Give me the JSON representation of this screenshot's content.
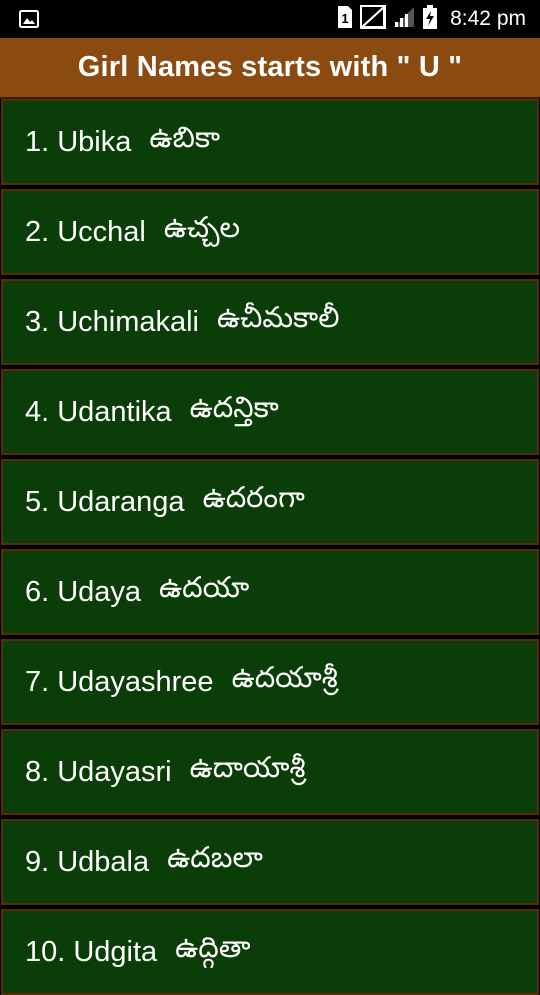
{
  "status_bar": {
    "time": "8:42 pm",
    "sim_label": "1",
    "icons": [
      "image-icon",
      "sim-card-icon",
      "no-signal-icon",
      "signal-icon",
      "battery-charging-icon"
    ]
  },
  "header": {
    "title": "Girl Names starts with \" U \""
  },
  "colors": {
    "header_bg": "#8b4a10",
    "item_bg": "#0b3d08",
    "item_border": "#5a2b0b"
  },
  "names": [
    {
      "num": "1.",
      "english": "Ubika",
      "telugu": "ఉబికా"
    },
    {
      "num": "2.",
      "english": "Ucchal",
      "telugu": "ఉచ్చల"
    },
    {
      "num": "3.",
      "english": "Uchimakali",
      "telugu": "ఉచీమకాలీ"
    },
    {
      "num": "4.",
      "english": "Udantika",
      "telugu": "ఉదన్తికా"
    },
    {
      "num": "5.",
      "english": "Udaranga",
      "telugu": "ఉదరంగా"
    },
    {
      "num": "6.",
      "english": "Udaya",
      "telugu": "ఉదయా"
    },
    {
      "num": "7.",
      "english": "Udayashree",
      "telugu": "ఉదయాశ్రీ"
    },
    {
      "num": "8.",
      "english": "Udayasri",
      "telugu": "ఉదాయాశ్రీ"
    },
    {
      "num": "9.",
      "english": "Udbala",
      "telugu": "ఉదబలా"
    },
    {
      "num": "10.",
      "english": "Udgita",
      "telugu": "ఉద్గితా"
    }
  ]
}
